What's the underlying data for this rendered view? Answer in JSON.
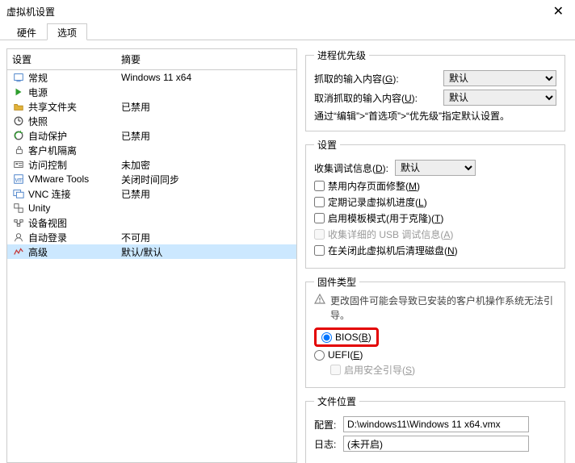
{
  "titlebar": {
    "title": "虚拟机设置",
    "close": "✕"
  },
  "tabs": {
    "hardware": "硬件",
    "options": "选项"
  },
  "list": {
    "headers": {
      "name": "设置",
      "summary": "摘要"
    },
    "items": [
      {
        "id": "general",
        "icon": "general",
        "name": "常规",
        "summary": "Windows 11 x64"
      },
      {
        "id": "power",
        "icon": "power",
        "name": "电源",
        "summary": ""
      },
      {
        "id": "shared",
        "icon": "shared",
        "name": "共享文件夹",
        "summary": "已禁用"
      },
      {
        "id": "snapshot",
        "icon": "snapshot",
        "name": "快照",
        "summary": ""
      },
      {
        "id": "autoprot",
        "icon": "autoprot",
        "name": "自动保护",
        "summary": "已禁用"
      },
      {
        "id": "guestiso",
        "icon": "guestiso",
        "name": "客户机隔离",
        "summary": ""
      },
      {
        "id": "access",
        "icon": "access",
        "name": "访问控制",
        "summary": "未加密"
      },
      {
        "id": "vmtools",
        "icon": "vmtools",
        "name": "VMware Tools",
        "summary": "关闭时间同步"
      },
      {
        "id": "vnc",
        "icon": "vnc",
        "name": "VNC 连接",
        "summary": "已禁用"
      },
      {
        "id": "unity",
        "icon": "unity",
        "name": "Unity",
        "summary": ""
      },
      {
        "id": "devview",
        "icon": "devview",
        "name": "设备视图",
        "summary": ""
      },
      {
        "id": "autologin",
        "icon": "autologin",
        "name": "自动登录",
        "summary": "不可用"
      },
      {
        "id": "advanced",
        "icon": "advanced",
        "name": "高级",
        "summary": "默认/默认"
      }
    ],
    "selected": "advanced"
  },
  "right": {
    "priority": {
      "legend": "进程优先级",
      "grabbed_label_pre": "抓取的输入内容(",
      "grabbed_u": "G",
      "grabbed_label_post": "):",
      "ungrabbed_label_pre": "取消抓取的输入内容(",
      "ungrabbed_u": "U",
      "ungrabbed_label_post": "):",
      "value": "默认",
      "note": "通过“编辑”>“首选项”>“优先级”指定默认设置。"
    },
    "settings": {
      "legend": "设置",
      "debug_label_pre": "收集调试信息(",
      "debug_u": "D",
      "debug_label_post": "):",
      "debug_value": "默认",
      "chk1_pre": "禁用内存页面修整(",
      "chk1_u": "M",
      "chk1_post": ")",
      "chk2_pre": "定期记录虚拟机进度(",
      "chk2_u": "L",
      "chk2_post": ")",
      "chk3_pre": "启用模板模式(用于克隆)(",
      "chk3_u": "T",
      "chk3_post": ")",
      "chk4_pre": "收集详细的 USB 调试信息(",
      "chk4_u": "A",
      "chk4_post": ")",
      "chk5_pre": "在关闭此虚拟机后清理磁盘(",
      "chk5_u": "N",
      "chk5_post": ")"
    },
    "firmware": {
      "legend": "固件类型",
      "warn": "更改固件可能会导致已安装的客户机操作系统无法引导。",
      "bios_pre": "BIOS(",
      "bios_u": "B",
      "bios_post": ")",
      "uefi_pre": "UEFI(",
      "uefi_u": "E",
      "uefi_post": ")",
      "secure_pre": "启用安全引导(",
      "secure_u": "S",
      "secure_post": ")"
    },
    "fileloc": {
      "legend": "文件位置",
      "config_label": "配置:",
      "config_value": "D:\\windows11\\Windows 11 x64.vmx",
      "log_label": "日志:",
      "log_value": "(未开启)"
    }
  }
}
